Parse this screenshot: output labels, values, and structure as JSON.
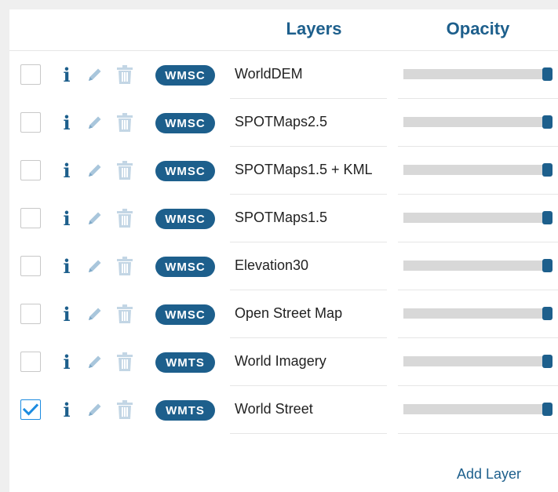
{
  "header": {
    "layers_label": "Layers",
    "opacity_label": "Opacity"
  },
  "icons": {
    "info": "info-icon",
    "edit": "pencil-icon",
    "delete": "trash-icon",
    "check": "checkmark-icon"
  },
  "colors": {
    "accent": "#1d5f8c",
    "checkbox_checked": "#1c8be0",
    "track": "#d8d8d8"
  },
  "layers": [
    {
      "type": "WMSC",
      "name": "WorldDEM",
      "checked": false,
      "opacity": 1.0
    },
    {
      "type": "WMSC",
      "name": "SPOTMaps2.5",
      "checked": false,
      "opacity": 1.0
    },
    {
      "type": "WMSC",
      "name": "SPOTMaps1.5 + KML",
      "checked": false,
      "opacity": 1.0
    },
    {
      "type": "WMSC",
      "name": "SPOTMaps1.5",
      "checked": false,
      "opacity": 1.0
    },
    {
      "type": "WMSC",
      "name": "Elevation30",
      "checked": false,
      "opacity": 1.0
    },
    {
      "type": "WMSC",
      "name": "Open Street Map",
      "checked": false,
      "opacity": 1.0
    },
    {
      "type": "WMTS",
      "name": "World Imagery",
      "checked": false,
      "opacity": 1.0
    },
    {
      "type": "WMTS",
      "name": "World Street",
      "checked": true,
      "opacity": 1.0
    }
  ],
  "footer": {
    "add_layer_label": "Add Layer"
  }
}
